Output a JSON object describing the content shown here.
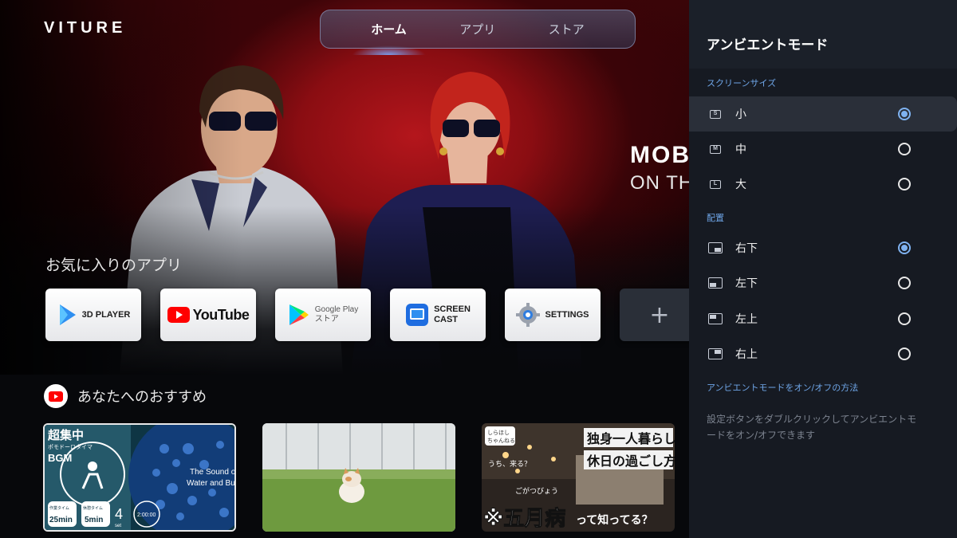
{
  "brand": {
    "logo_text": "VITURE"
  },
  "topnav": {
    "tabs": [
      {
        "label": "ホーム",
        "active": true
      },
      {
        "label": "アプリ",
        "active": false
      },
      {
        "label": "ストア",
        "active": false
      }
    ]
  },
  "hero": {
    "title": "MOB",
    "subtitle": "ON TH"
  },
  "favorites": {
    "title": "お気に入りのアプリ",
    "apps": [
      {
        "label": "3D PLAYER",
        "icon": "3d-player-icon"
      },
      {
        "label": "YouTube",
        "icon": "youtube-icon"
      },
      {
        "label_line1": "Google Play",
        "label_line2": "ストア",
        "icon": "google-play-icon"
      },
      {
        "label_line1": "SCREEN",
        "label_line2": "CAST",
        "icon": "screen-cast-icon"
      },
      {
        "label": "SETTINGS",
        "icon": "settings-gear-icon"
      },
      {
        "label": "+",
        "icon": "add-icon"
      }
    ]
  },
  "recommendations": {
    "title": "あなたへのおすすめ",
    "videos": [
      {
        "title_line1": "超集中",
        "tag": "ポモドーロタイマ",
        "bgm": "BGM",
        "side_line1": "The Sound of",
        "side_line2": "Water and Bubble",
        "focus_label": "作業タイム",
        "focus_time": "25min",
        "break_label": "休憩タイム",
        "break_time": "5min",
        "repeat": "4",
        "repeat_unit": "set",
        "clock": "2:00:00"
      },
      {
        "description": "kitten on grass"
      },
      {
        "badge_line1": "しらほし",
        "badge_line2": "ちゃんねる",
        "line1": "独身一人暮らし",
        "line2": "休日の過ごし方",
        "speech": "うち、来る？",
        "ruby": "ごがつびょう",
        "bottom": "※五月病",
        "bottom_tail": "って知ってる？"
      }
    ]
  },
  "panel": {
    "title": "アンビエントモード",
    "size_section": "スクリーンサイズ",
    "sizes": [
      {
        "label": "小",
        "icon_letter": "S",
        "selected": true
      },
      {
        "label": "中",
        "icon_letter": "M",
        "selected": false
      },
      {
        "label": "大",
        "icon_letter": "L",
        "selected": false
      }
    ],
    "position_section": "配置",
    "positions": [
      {
        "label": "右下",
        "selected": true
      },
      {
        "label": "左下",
        "selected": false
      },
      {
        "label": "左上",
        "selected": false
      },
      {
        "label": "右上",
        "selected": false
      }
    ],
    "help_title": "アンビエントモードをオン/オフの方法",
    "help_text": "設定ボタンをダブルクリックしてアンビエントモードをオン/オフできます"
  },
  "colors": {
    "accent": "#7fb2f0",
    "panel_bg": "#161a22",
    "hero_red": "#b4161c",
    "youtube_red": "#ff0000"
  }
}
